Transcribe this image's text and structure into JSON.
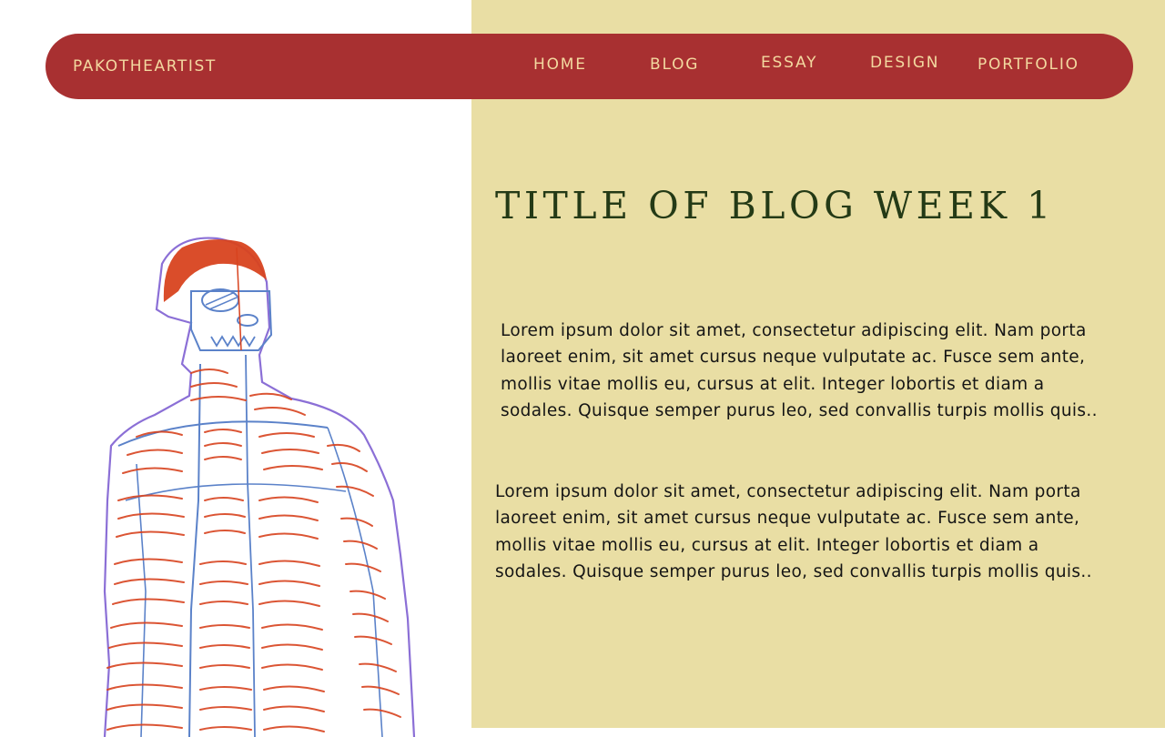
{
  "nav": {
    "brand": "PAKOTHEARTIST",
    "links": [
      "HOME",
      "BLOG",
      "ESSAY",
      "DESIGN",
      "PORTFOLIO"
    ]
  },
  "post": {
    "title": "TITLE OF BLOG WEEK 1",
    "paragraphs": [
      "Lorem ipsum dolor sit amet, consectetur adipiscing elit. Nam porta laoreet enim, sit amet cursus neque vulputate ac. Fusce sem ante, mollis vitae mollis eu, cursus at elit. Integer lobortis et diam a sodales. Quisque semper purus leo, sed convallis turpis mollis quis..",
      "Lorem ipsum dolor sit amet, consectetur adipiscing elit. Nam porta laoreet enim, sit amet cursus neque vulputate ac. Fusce sem ante, mollis vitae mollis eu, cursus at elit. Integer lobortis et diam a sodales. Quisque semper purus leo, sed convallis turpis mollis quis.."
    ]
  },
  "colors": {
    "nav_bg": "#a83031",
    "nav_text": "#f3d9a0",
    "panel_bg": "#e9dea4",
    "title": "#243a16",
    "sketch_red": "#d8431f",
    "sketch_blue": "#5b82c9",
    "sketch_purple": "#8b6fd6"
  },
  "illustration": {
    "icon": "anatomy-sketch-figure"
  }
}
